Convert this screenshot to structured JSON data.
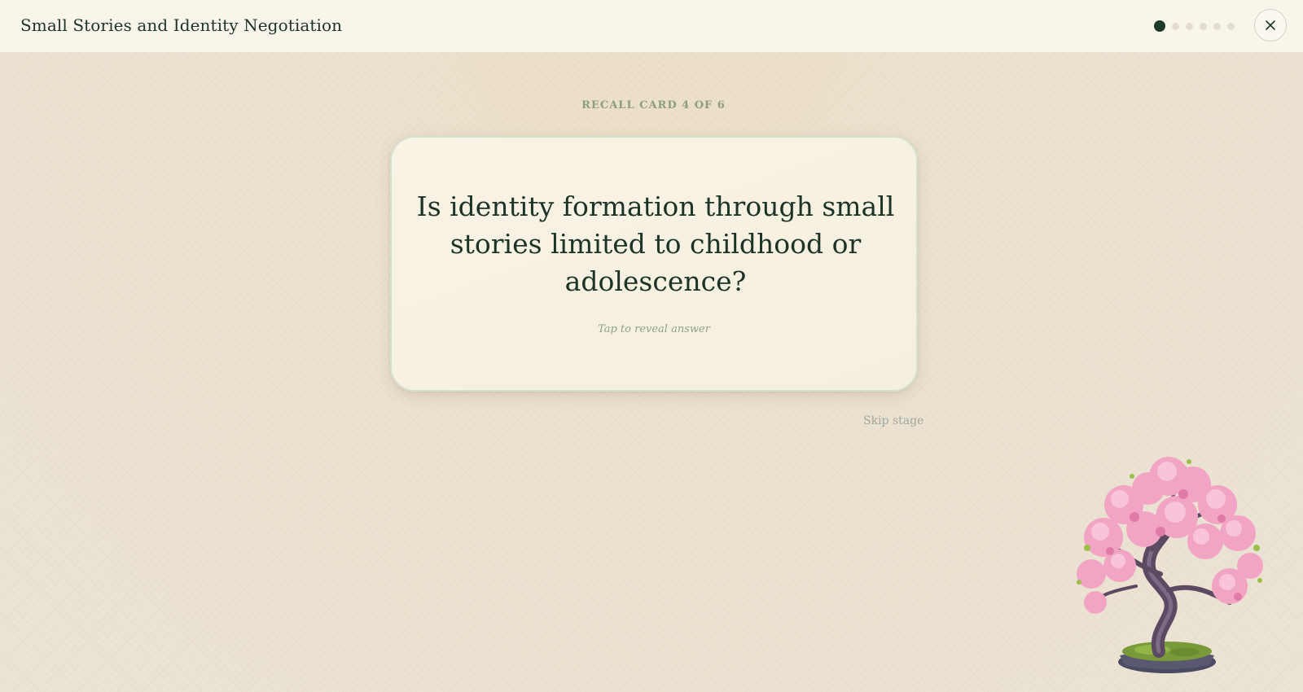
{
  "header": {
    "title": "Small Stories and Identity Negotiation",
    "progress_dots": {
      "total": 6,
      "active_index": 0
    },
    "close_icon": "close-icon"
  },
  "main": {
    "card_label": "RECALL CARD 4 OF 6",
    "card": {
      "question": "Is identity formation through small stories limited to childhood or adolescence?",
      "hint": "Tap to reveal answer"
    },
    "skip_label": "Skip stage"
  },
  "decoration": {
    "illustration": "cherry-blossom-bonsai-icon"
  },
  "colors": {
    "accent": "#1f3a2b",
    "background": "#ece2d0",
    "card": "#f8f2e4",
    "card_border": "#d7e0cf",
    "muted_green": "#8c9d84",
    "blossom": "#f2a4c4"
  }
}
